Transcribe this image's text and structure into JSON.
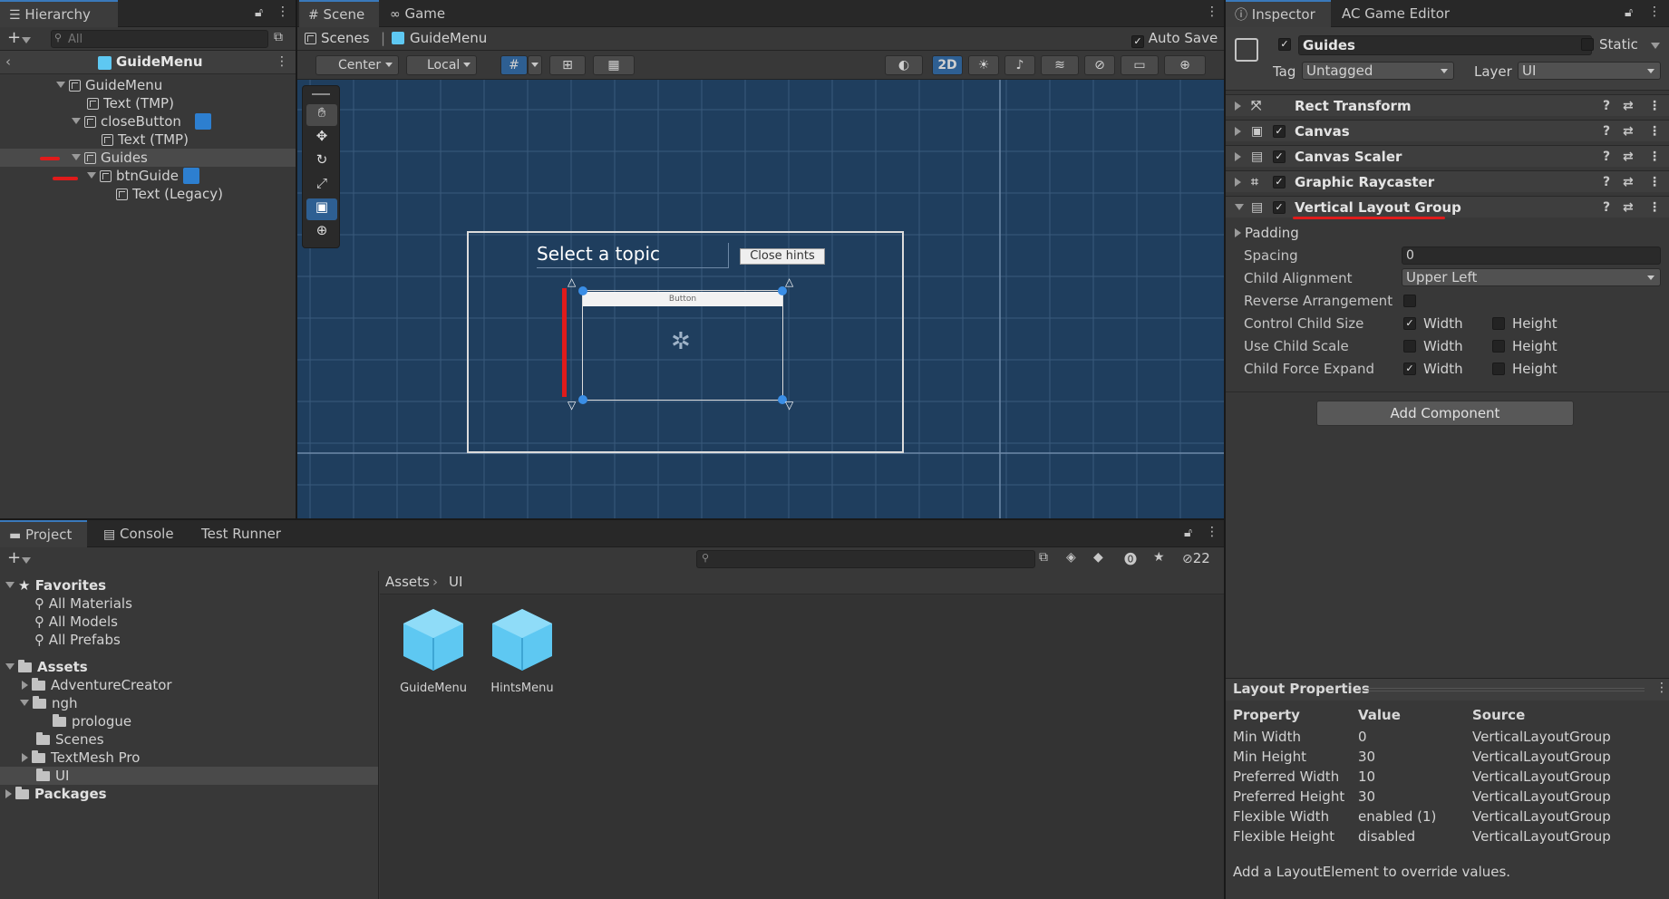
{
  "hierarchy": {
    "tab": "Hierarchy",
    "search_placeholder": "All",
    "scene_name": "GuideMenu",
    "items": [
      {
        "label": "GuideMenu"
      },
      {
        "label": "Text (TMP)"
      },
      {
        "label": "closeButton"
      },
      {
        "label": "Text (TMP)"
      },
      {
        "label": "Guides"
      },
      {
        "label": "btnGuide"
      },
      {
        "label": "Text (Legacy)"
      }
    ]
  },
  "scene_tabs": {
    "scene": "Scene",
    "game": "Game"
  },
  "breadcrumb": {
    "scenes": "Scenes",
    "current": "GuideMenu",
    "auto_save": "Auto Save"
  },
  "scene_toolbar": {
    "pivot": "Center",
    "space": "Local",
    "mode_2d": "2D"
  },
  "canvas_ui": {
    "title": "Select a topic",
    "close": "Close hints",
    "button": "Button"
  },
  "inspector": {
    "tabs": [
      "Inspector",
      "AC Game Editor"
    ],
    "object_name": "Guides",
    "static_label": "Static",
    "tag_label": "Tag",
    "tag_value": "Untagged",
    "layer_label": "Layer",
    "layer_value": "UI",
    "components": [
      "Rect Transform",
      "Canvas",
      "Canvas Scaler",
      "Graphic Raycaster",
      "Vertical Layout Group"
    ],
    "padding": "Padding",
    "spacing_label": "Spacing",
    "spacing_value": "0",
    "child_alignment_label": "Child Alignment",
    "child_alignment_value": "Upper Left",
    "reverse_label": "Reverse Arrangement",
    "control_label": "Control Child Size",
    "scale_label": "Use Child Scale",
    "force_label": "Child Force Expand",
    "width": "Width",
    "height": "Height",
    "add_component": "Add Component",
    "checks": {
      "control_width": true,
      "control_height": false,
      "scale_width": false,
      "scale_height": false,
      "force_width": true,
      "force_height": false
    }
  },
  "layout_props": {
    "title": "Layout Properties",
    "headers": [
      "Property",
      "Value",
      "Source"
    ],
    "rows": [
      [
        "Min Width",
        "0",
        "VerticalLayoutGroup"
      ],
      [
        "Min Height",
        "30",
        "VerticalLayoutGroup"
      ],
      [
        "Preferred Width",
        "10",
        "VerticalLayoutGroup"
      ],
      [
        "Preferred Height",
        "30",
        "VerticalLayoutGroup"
      ],
      [
        "Flexible Width",
        "enabled (1)",
        "VerticalLayoutGroup"
      ],
      [
        "Flexible Height",
        "disabled",
        "VerticalLayoutGroup"
      ]
    ],
    "note": "Add a LayoutElement to override values."
  },
  "project": {
    "tabs": [
      "Project",
      "Console",
      "Test Runner"
    ],
    "hidden_count": "22",
    "favorites": "Favorites",
    "fav_items": [
      "All Materials",
      "All Models",
      "All Prefabs"
    ],
    "assets": "Assets",
    "folders": [
      "AdventureCreator",
      "ngh",
      "prologue",
      "Scenes",
      "TextMesh Pro",
      "UI"
    ],
    "packages": "Packages",
    "path": [
      "Assets",
      "UI"
    ],
    "prefabs": [
      "GuideMenu",
      "HintsMenu"
    ]
  },
  "colors": {
    "accent": "#3a79bb",
    "scene_bg": "#1f3e5e",
    "prefab": "#5ec8f2",
    "annotation": "#e01b1b"
  }
}
